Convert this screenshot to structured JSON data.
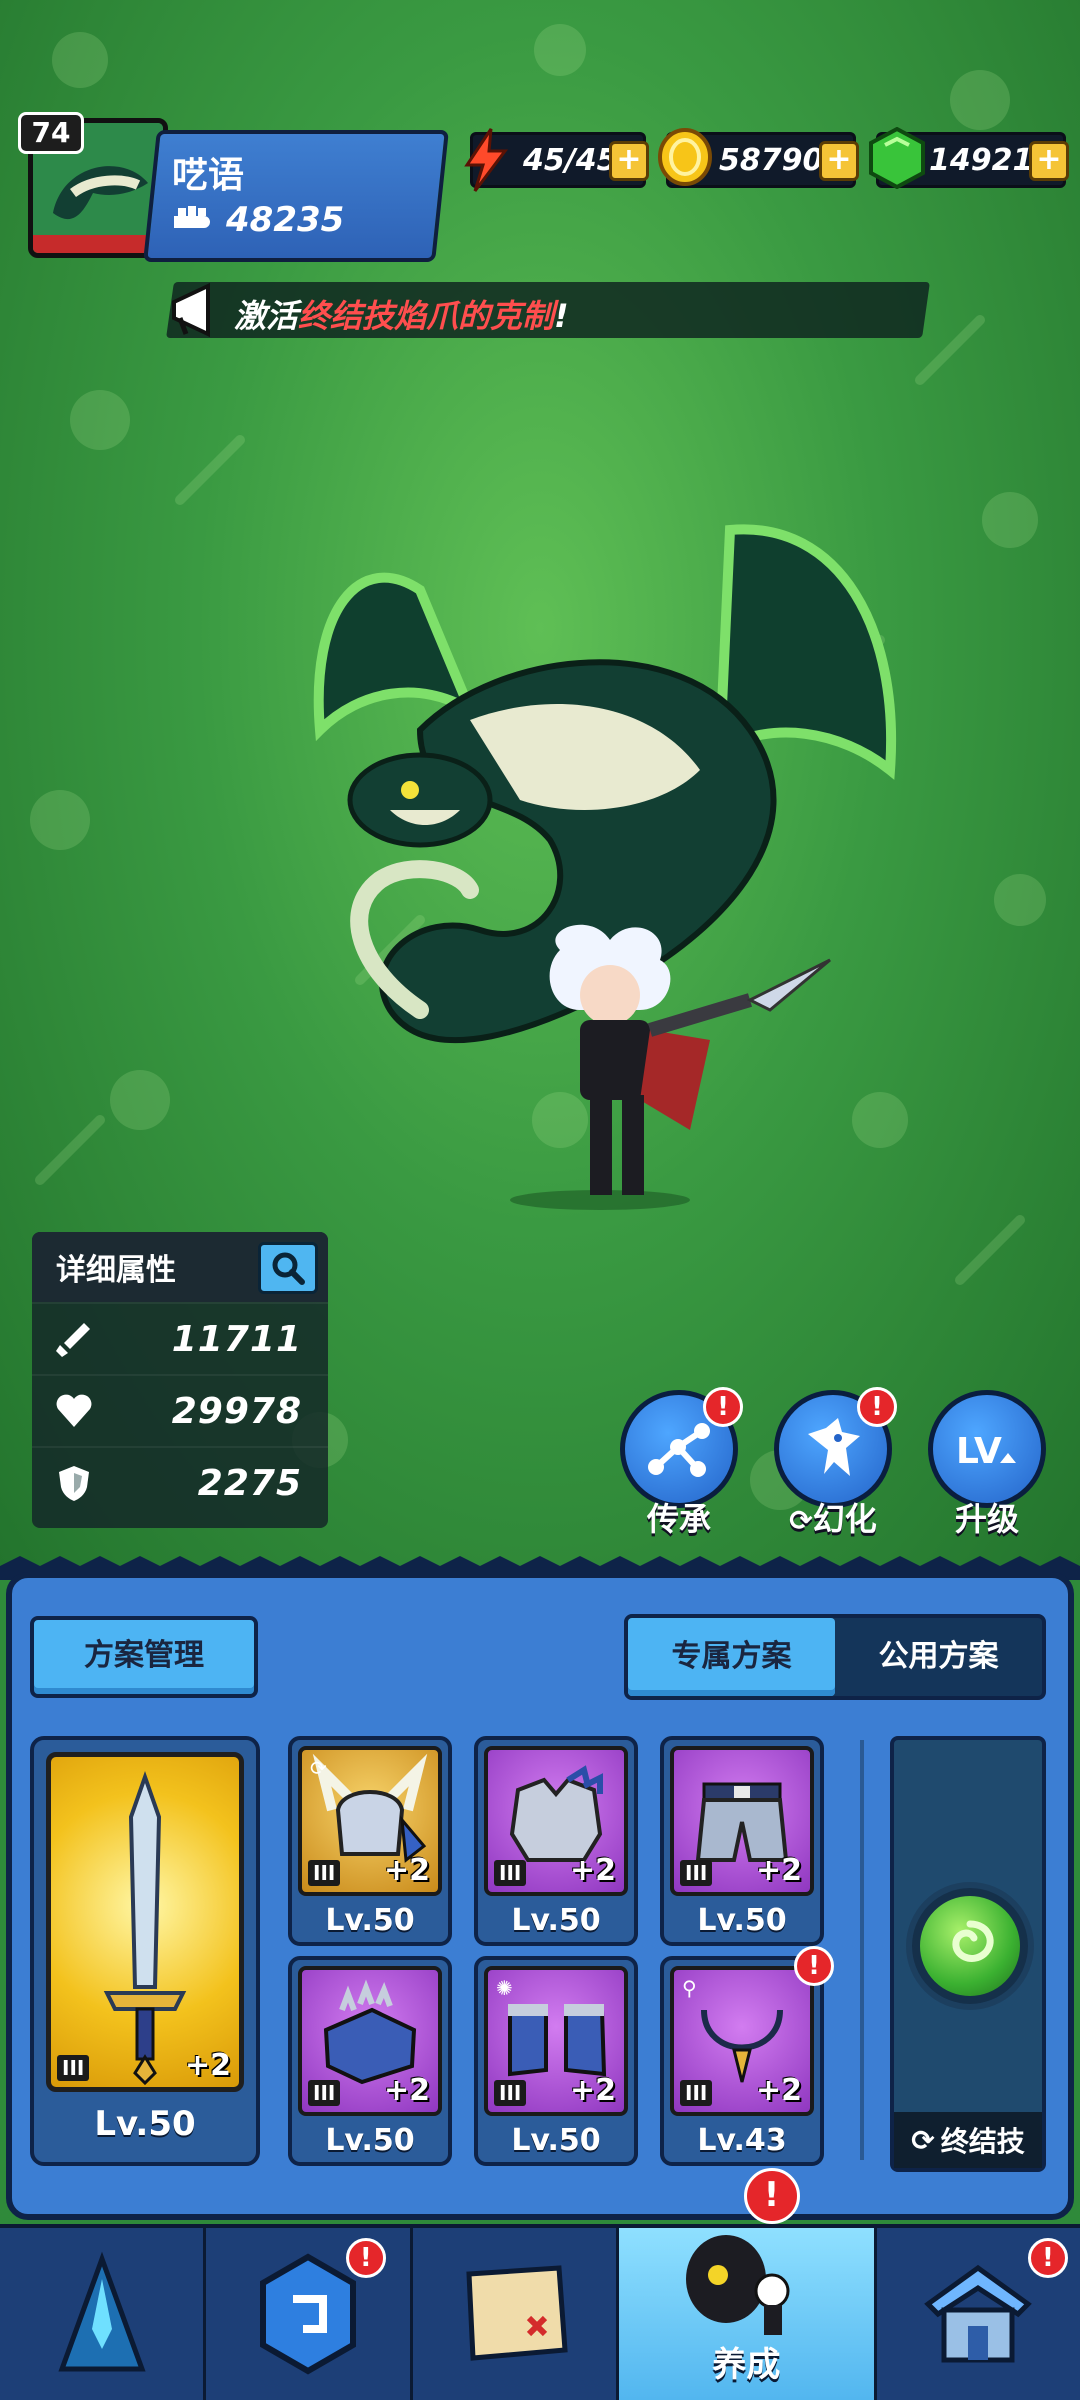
{
  "player": {
    "level": "74",
    "name": "呓语",
    "power": "48235"
  },
  "resources": {
    "stamina": "45/45",
    "gold": "58790",
    "gems": "14921",
    "plus": "+"
  },
  "notice": {
    "prefix": "激活",
    "highlight": "终结技焰爪的克制",
    "suffix": "!"
  },
  "stats": {
    "title": "详细属性",
    "attack": "11711",
    "hp": "29978",
    "defense": "2275"
  },
  "actions": [
    {
      "label": "传承",
      "badge": "!"
    },
    {
      "label": "幻化",
      "badge": "!"
    },
    {
      "label": "升级"
    }
  ],
  "plan": {
    "manage_label": "方案管理",
    "tabs": [
      "专属方案",
      "公用方案"
    ],
    "active_tab": "专属方案"
  },
  "equipment": {
    "weapon": {
      "tier": "III",
      "plus": "+2",
      "level": "Lv.50"
    },
    "gear": [
      {
        "tier": "III",
        "plus": "+2",
        "level": "Lv.50",
        "name": "helmet-icon"
      },
      {
        "tier": "III",
        "plus": "+2",
        "level": "Lv.50",
        "name": "armor-icon"
      },
      {
        "tier": "III",
        "plus": "+2",
        "level": "Lv.50",
        "name": "pants-icon"
      },
      {
        "tier": "III",
        "plus": "+2",
        "level": "Lv.50",
        "name": "gauntlet-icon"
      },
      {
        "tier": "III",
        "plus": "+2",
        "level": "Lv.50",
        "name": "boots-icon"
      },
      {
        "tier": "III",
        "plus": "+2",
        "level": "Lv.43",
        "name": "necklace-icon",
        "badge": "!"
      }
    ]
  },
  "finisher": {
    "label": "终结技"
  },
  "nav": {
    "active_label": "养成",
    "badge": "!"
  },
  "colors": {
    "panel": "#3c7ed3",
    "accent": "#4db4f3",
    "alert": "#e5262a",
    "gold": "#f5c437"
  }
}
